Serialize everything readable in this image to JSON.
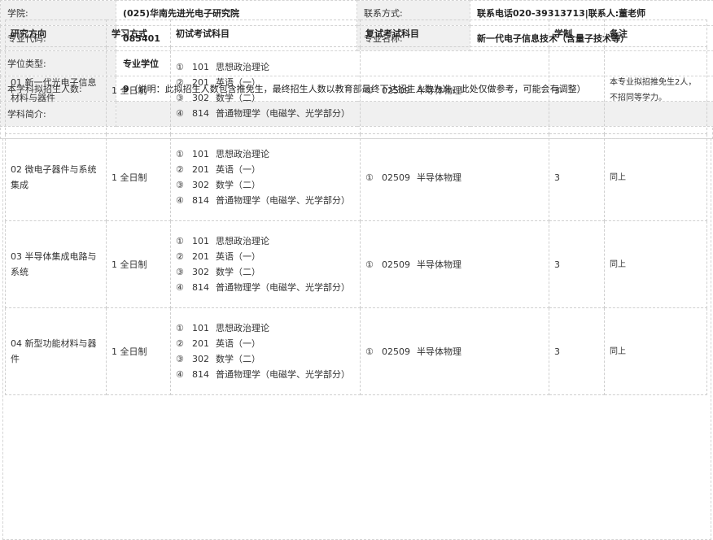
{
  "info": {
    "college_label": "学院:",
    "college_value": "(025)华南先进光电子研究院",
    "contact_label": "联系方式:",
    "contact_value": "联系电话020-39313713|联系人:董老师",
    "major_code_label": "专业代码:",
    "major_code_value": "085401",
    "major_name_label": "专业名称:",
    "major_name_value": "新一代电子信息技术（含量子技术等）",
    "degree_type_label": "学位类型:",
    "degree_type_value": "专业学位",
    "enroll_label": "本学科拟招生人数:",
    "enroll_count": "9",
    "enroll_note": "（说明：此拟招生人数包含推免生，最终招生人数以教育部最终下达招生人数为准，此处仅做参考，可能会有调整）",
    "intro_label": "学科简介:"
  },
  "directions": {
    "headers": [
      "研究方向",
      "学习方式",
      "初试考试科目",
      "复试考试科目",
      "学制",
      "备注"
    ],
    "rows": [
      {
        "direction": "01 新一代光电子信息材料与器件",
        "mode": "1 全日制",
        "prelim": [
          {
            "num": "①",
            "code": "101",
            "name": "思想政治理论"
          },
          {
            "num": "②",
            "code": "201",
            "name": "英语（一）"
          },
          {
            "num": "③",
            "code": "302",
            "name": "数学（二）"
          },
          {
            "num": "④",
            "code": "814",
            "name": "普通物理学（电磁学、光学部分）"
          }
        ],
        "retest": {
          "num": "①",
          "code": "02509",
          "name": "半导体物理"
        },
        "years": "3",
        "note": "本专业拟招推免生2人，不招同等学力。"
      },
      {
        "direction": "02 微电子器件与系统集成",
        "mode": "1 全日制",
        "prelim": [
          {
            "num": "①",
            "code": "101",
            "name": "思想政治理论"
          },
          {
            "num": "②",
            "code": "201",
            "name": "英语（一）"
          },
          {
            "num": "③",
            "code": "302",
            "name": "数学（二）"
          },
          {
            "num": "④",
            "code": "814",
            "name": "普通物理学（电磁学、光学部分）"
          }
        ],
        "retest": {
          "num": "①",
          "code": "02509",
          "name": "半导体物理"
        },
        "years": "3",
        "note": "同上"
      },
      {
        "direction": "03 半导体集成电路与系统",
        "mode": "1 全日制",
        "prelim": [
          {
            "num": "①",
            "code": "101",
            "name": "思想政治理论"
          },
          {
            "num": "②",
            "code": "201",
            "name": "英语（一）"
          },
          {
            "num": "③",
            "code": "302",
            "name": "数学（二）"
          },
          {
            "num": "④",
            "code": "814",
            "name": "普通物理学（电磁学、光学部分）"
          }
        ],
        "retest": {
          "num": "①",
          "code": "02509",
          "name": "半导体物理"
        },
        "years": "3",
        "note": "同上"
      },
      {
        "direction": "04 新型功能材料与器件",
        "mode": "1 全日制",
        "prelim": [
          {
            "num": "①",
            "code": "101",
            "name": "思想政治理论"
          },
          {
            "num": "②",
            "code": "201",
            "name": "英语（一）"
          },
          {
            "num": "③",
            "code": "302",
            "name": "数学（二）"
          },
          {
            "num": "④",
            "code": "814",
            "name": "普通物理学（电磁学、光学部分）"
          }
        ],
        "retest": {
          "num": "①",
          "code": "02509",
          "name": "半导体物理"
        },
        "years": "3",
        "note": "同上"
      }
    ]
  }
}
